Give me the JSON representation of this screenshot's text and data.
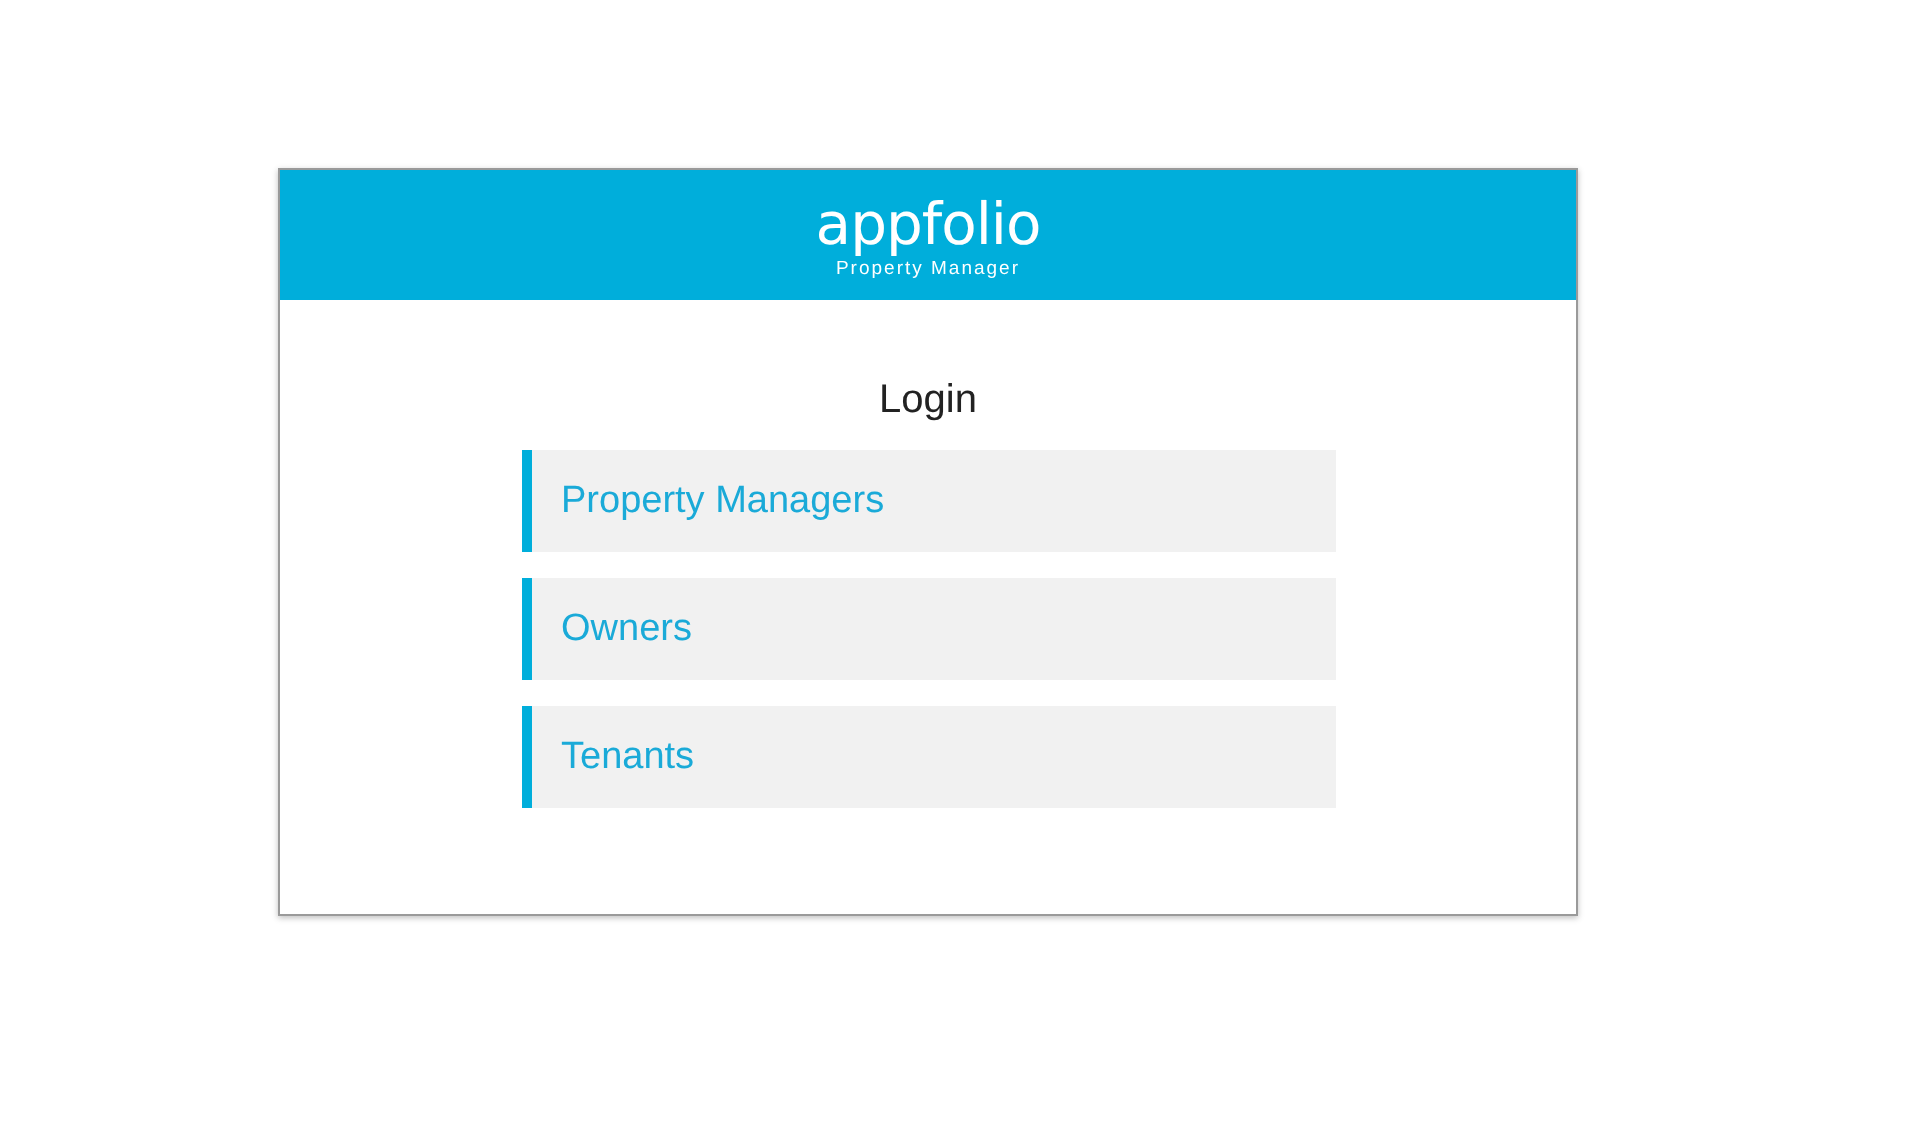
{
  "header": {
    "logo": "appfolio",
    "subtitle": "Property Manager"
  },
  "title": "Login",
  "options": [
    {
      "label": "Property Managers"
    },
    {
      "label": "Owners"
    },
    {
      "label": "Tenants"
    }
  ]
}
